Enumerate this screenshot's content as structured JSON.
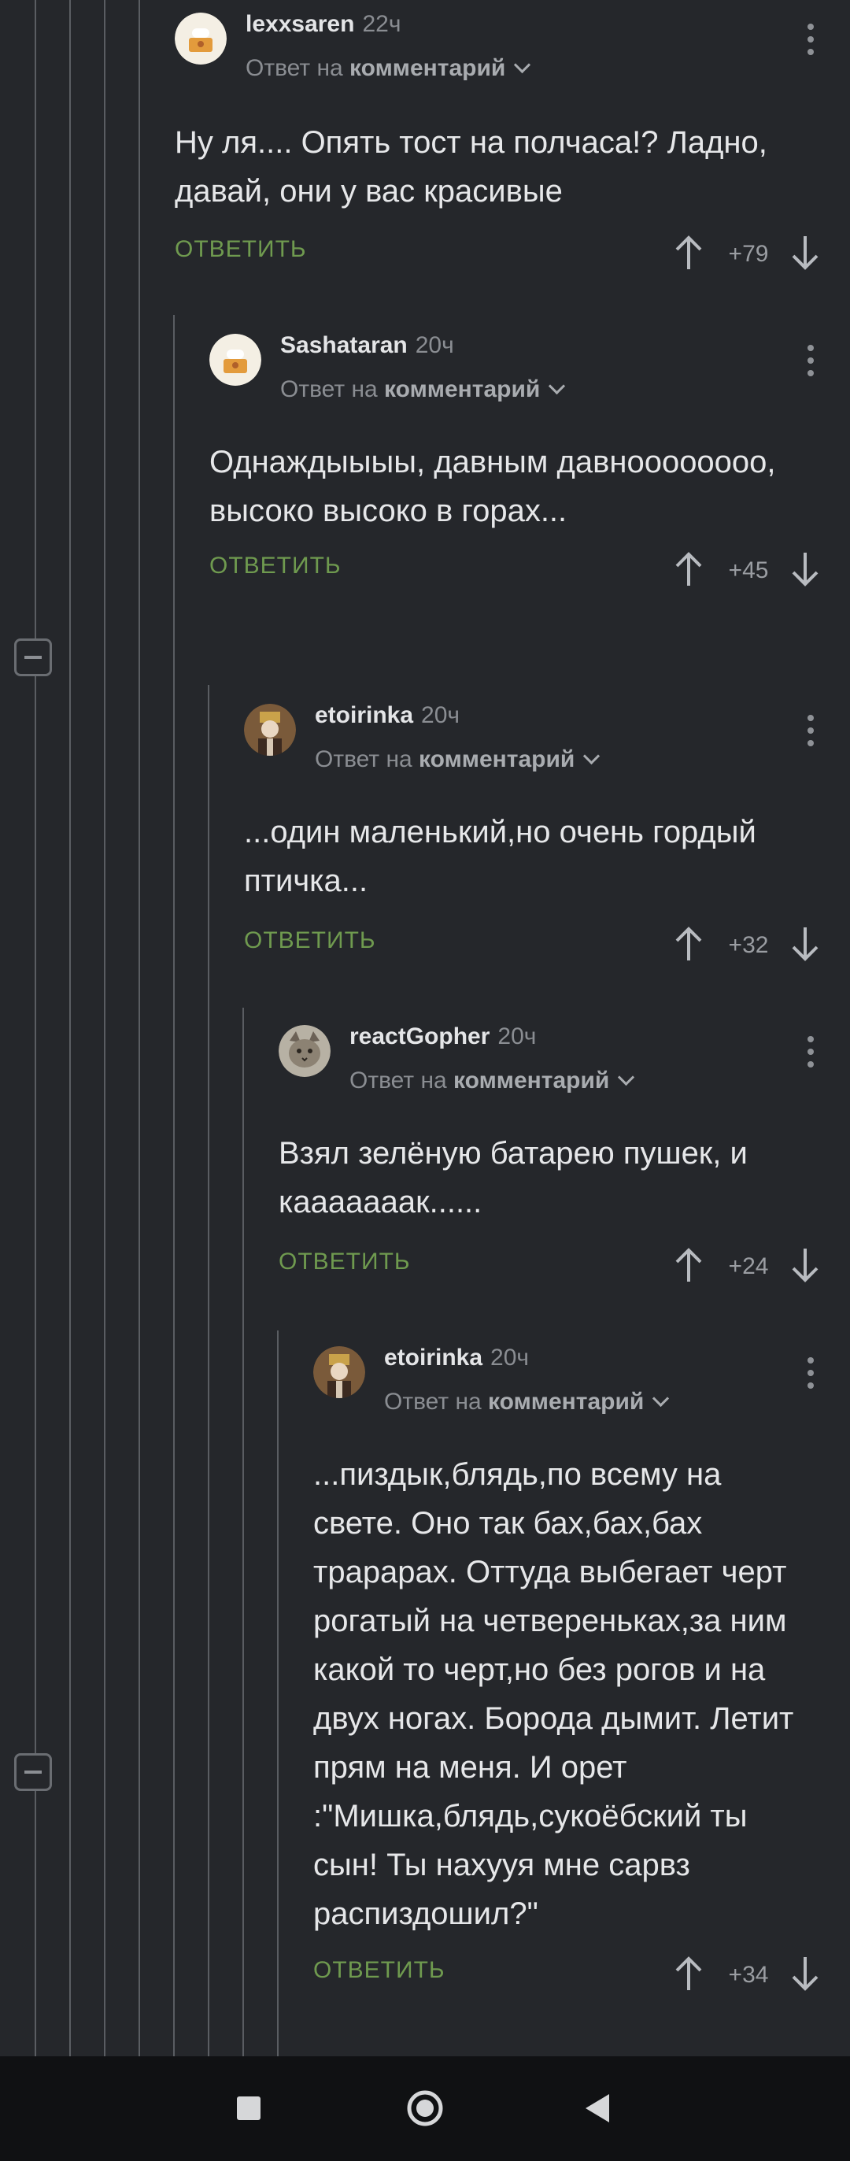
{
  "comments": [
    {
      "username": "lexxsaren",
      "time": "22ч",
      "reply_prefix": "Ответ на",
      "reply_target": "комментарий",
      "text": "Ну ля.... Опять тост на полчаса!? Ладно, давай, они у вас красивые",
      "reply_label": "ОТВЕТИТЬ",
      "score": "+79",
      "avatar": "cook-avatar"
    },
    {
      "username": "Sashataran",
      "time": "20ч",
      "reply_prefix": "Ответ на",
      "reply_target": "комментарий",
      "text": "Однаждыыыы, давным давноооооооо, высоко высоко в горах...",
      "reply_label": "ОТВЕТИТЬ",
      "score": "+45",
      "avatar": "cook-avatar"
    },
    {
      "username": "etoirinka",
      "time": "20ч",
      "reply_prefix": "Ответ на",
      "reply_target": "комментарий",
      "text": "...один маленький,но очень гордый птичка...",
      "reply_label": "ОТВЕТИТЬ",
      "score": "+32",
      "avatar": "portrait-avatar"
    },
    {
      "username": "reactGopher",
      "time": "20ч",
      "reply_prefix": "Ответ на",
      "reply_target": "комментарий",
      "text": "Взял зелёную батарею пушек, и кааааааак......",
      "reply_label": "ОТВЕТИТЬ",
      "score": "+24",
      "avatar": "cat-avatar"
    },
    {
      "username": "etoirinka",
      "time": "20ч",
      "reply_prefix": "Ответ на",
      "reply_target": "комментарий",
      "text": "...пиздык,блядь,по всему на свете. Оно так бах,бах,бах трарарах. Оттуда выбегает черт рогатый на четвереньках,за ним какой то черт,но без рогов и на двух ногах. Борода дымит. Летит прям на меня. И орет :\"Мишка,блядь,сукоёбский ты сын! Ты нахууя мне сарвз распиздошил?\"",
      "reply_label": "ОТВЕТИТЬ",
      "score": "+34",
      "avatar": "portrait-avatar"
    }
  ],
  "colors": {
    "background": "#25272b",
    "accent": "#6f9a4f",
    "navbar": "#101113"
  },
  "navbar": {
    "recent": "square-icon",
    "home": "circle-icon",
    "back": "triangle-back-icon"
  }
}
